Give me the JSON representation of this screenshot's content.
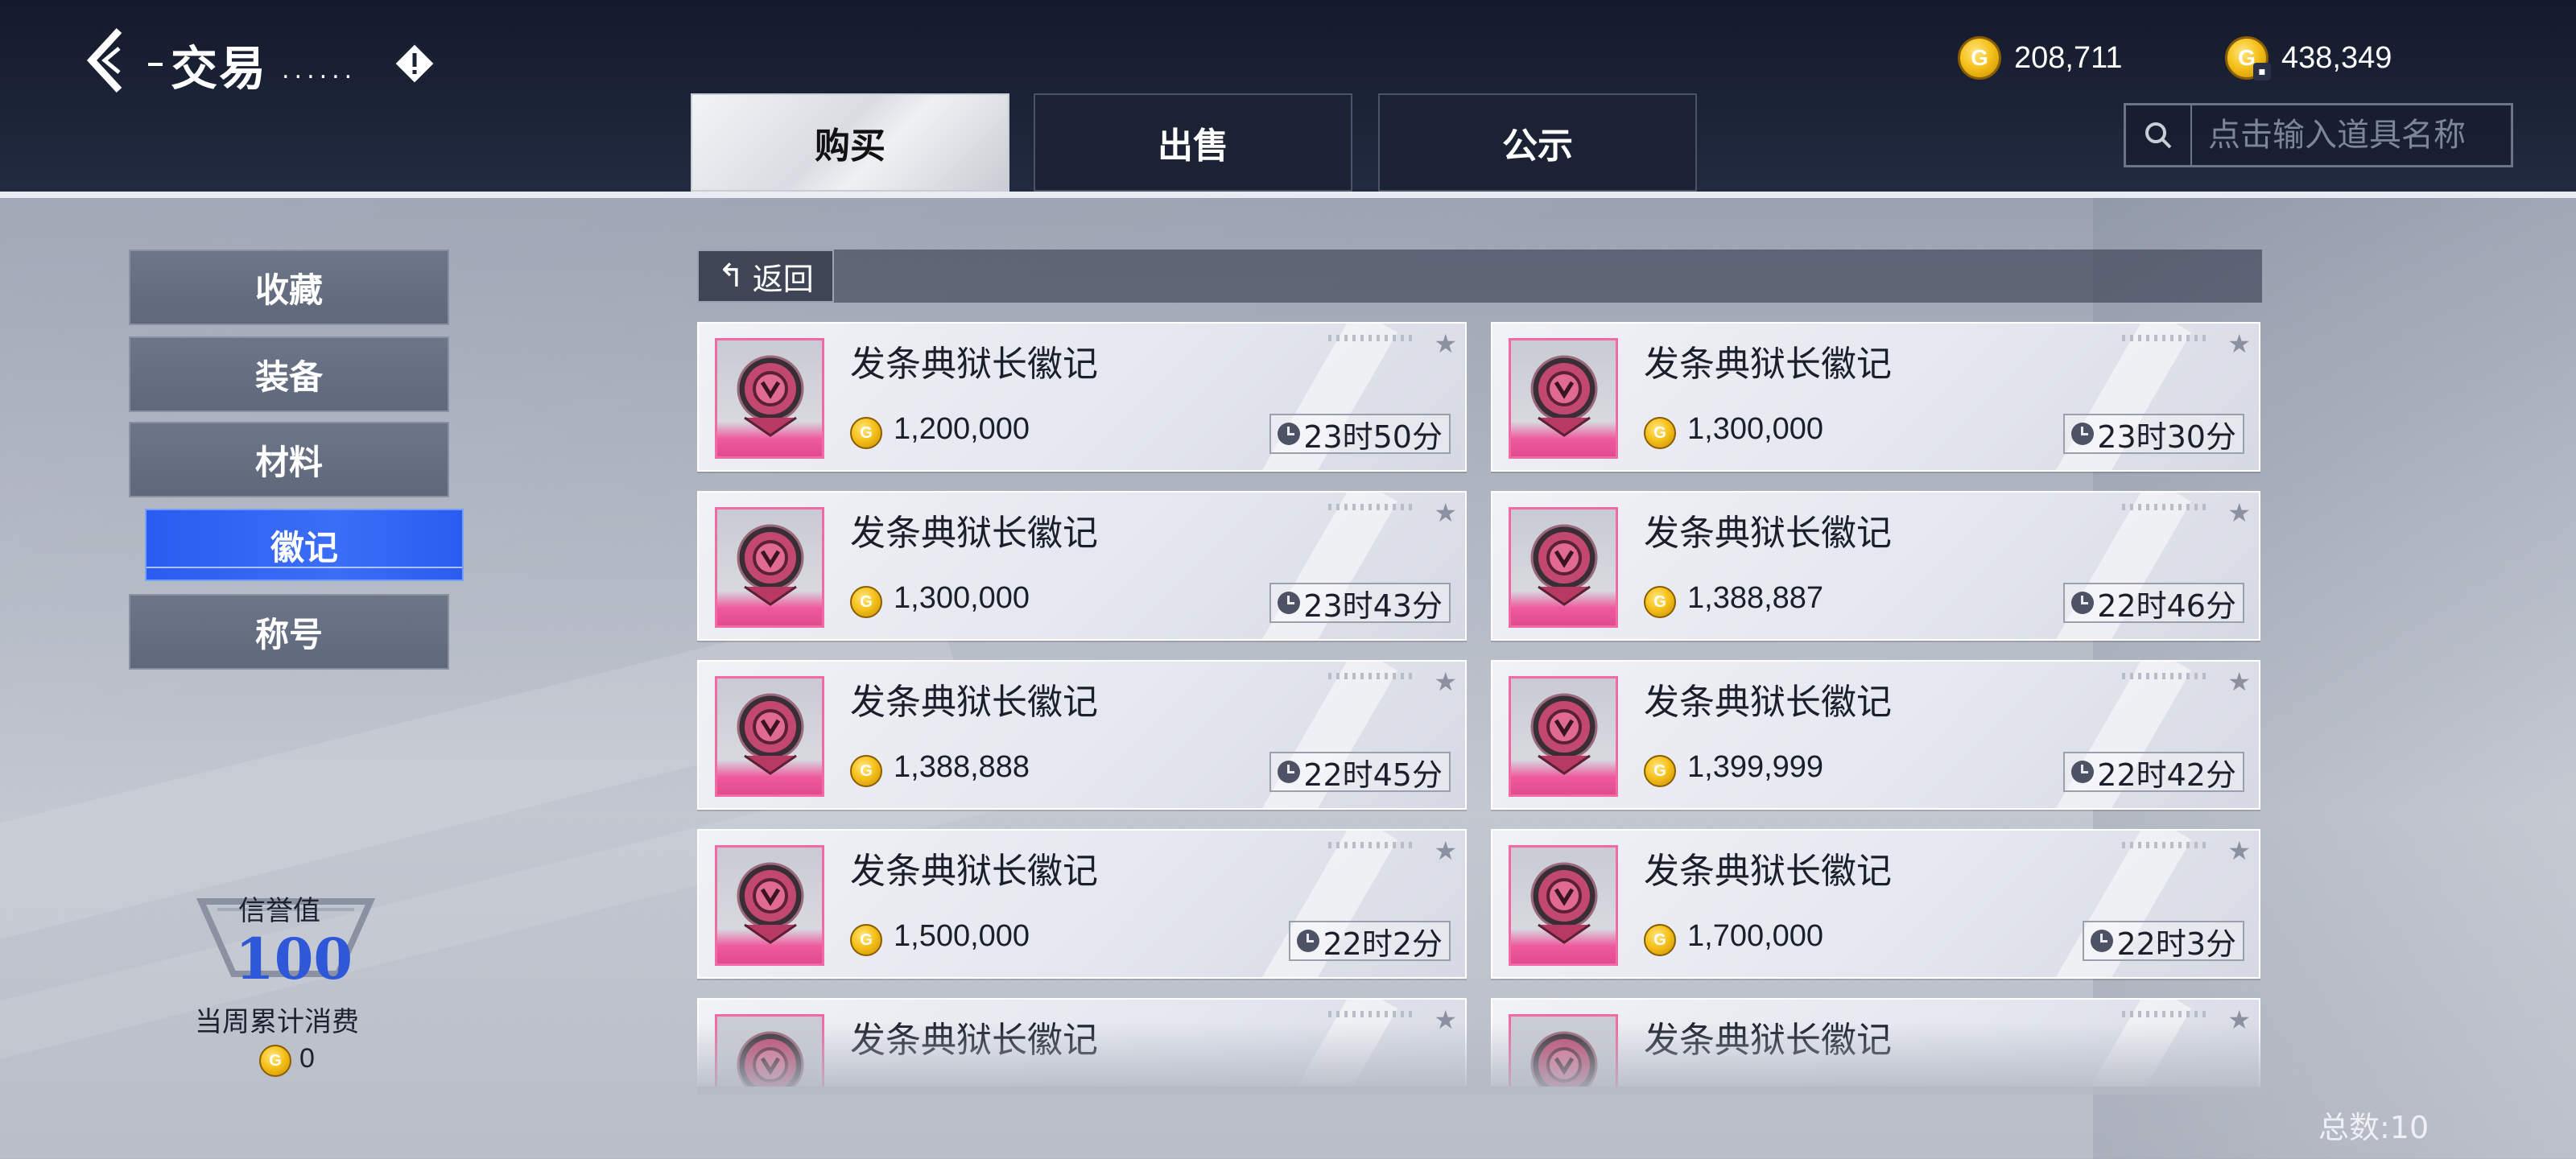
{
  "header": {
    "title": "交易",
    "title_dots": "......",
    "currencies": [
      {
        "icon": "gold-coin-icon",
        "value": "208,711"
      },
      {
        "icon": "bound-gold-coin-icon",
        "value": "438,349"
      }
    ],
    "tabs": [
      {
        "label": "购买",
        "active": true
      },
      {
        "label": "出售",
        "active": false
      },
      {
        "label": "公示",
        "active": false
      }
    ],
    "search_placeholder": "点击输入道具名称"
  },
  "sidebar": {
    "items": [
      {
        "label": "收藏",
        "active": false
      },
      {
        "label": "装备",
        "active": false
      },
      {
        "label": "材料",
        "active": false
      },
      {
        "label": "徽记",
        "active": true
      },
      {
        "label": "称号",
        "active": false
      }
    ]
  },
  "reputation": {
    "label": "信誉值",
    "value": "100",
    "weekly_label": "当周累计消费",
    "weekly_value": "0"
  },
  "list": {
    "back_label": "返回",
    "items": [
      {
        "name": "发条典狱长徽记",
        "price": "1,200,000",
        "time": "23时50分"
      },
      {
        "name": "发条典狱长徽记",
        "price": "1,300,000",
        "time": "23时30分"
      },
      {
        "name": "发条典狱长徽记",
        "price": "1,300,000",
        "time": "23时43分"
      },
      {
        "name": "发条典狱长徽记",
        "price": "1,388,887",
        "time": "22时46分"
      },
      {
        "name": "发条典狱长徽记",
        "price": "1,388,888",
        "time": "22时45分"
      },
      {
        "name": "发条典狱长徽记",
        "price": "1,399,999",
        "time": "22时42分"
      },
      {
        "name": "发条典狱长徽记",
        "price": "1,500,000",
        "time": "22时2分"
      },
      {
        "name": "发条典狱长徽记",
        "price": "1,700,000",
        "time": "22时3分"
      },
      {
        "name": "发条典狱长徽记",
        "price": "",
        "time": ""
      },
      {
        "name": "发条典狱长徽记",
        "price": "",
        "time": ""
      }
    ],
    "total_label": "总数:10"
  },
  "colors": {
    "accent_blue": "#3a6ef6",
    "badge_pink": "#ee5b9d",
    "coin_gold": "#f6c21c"
  }
}
